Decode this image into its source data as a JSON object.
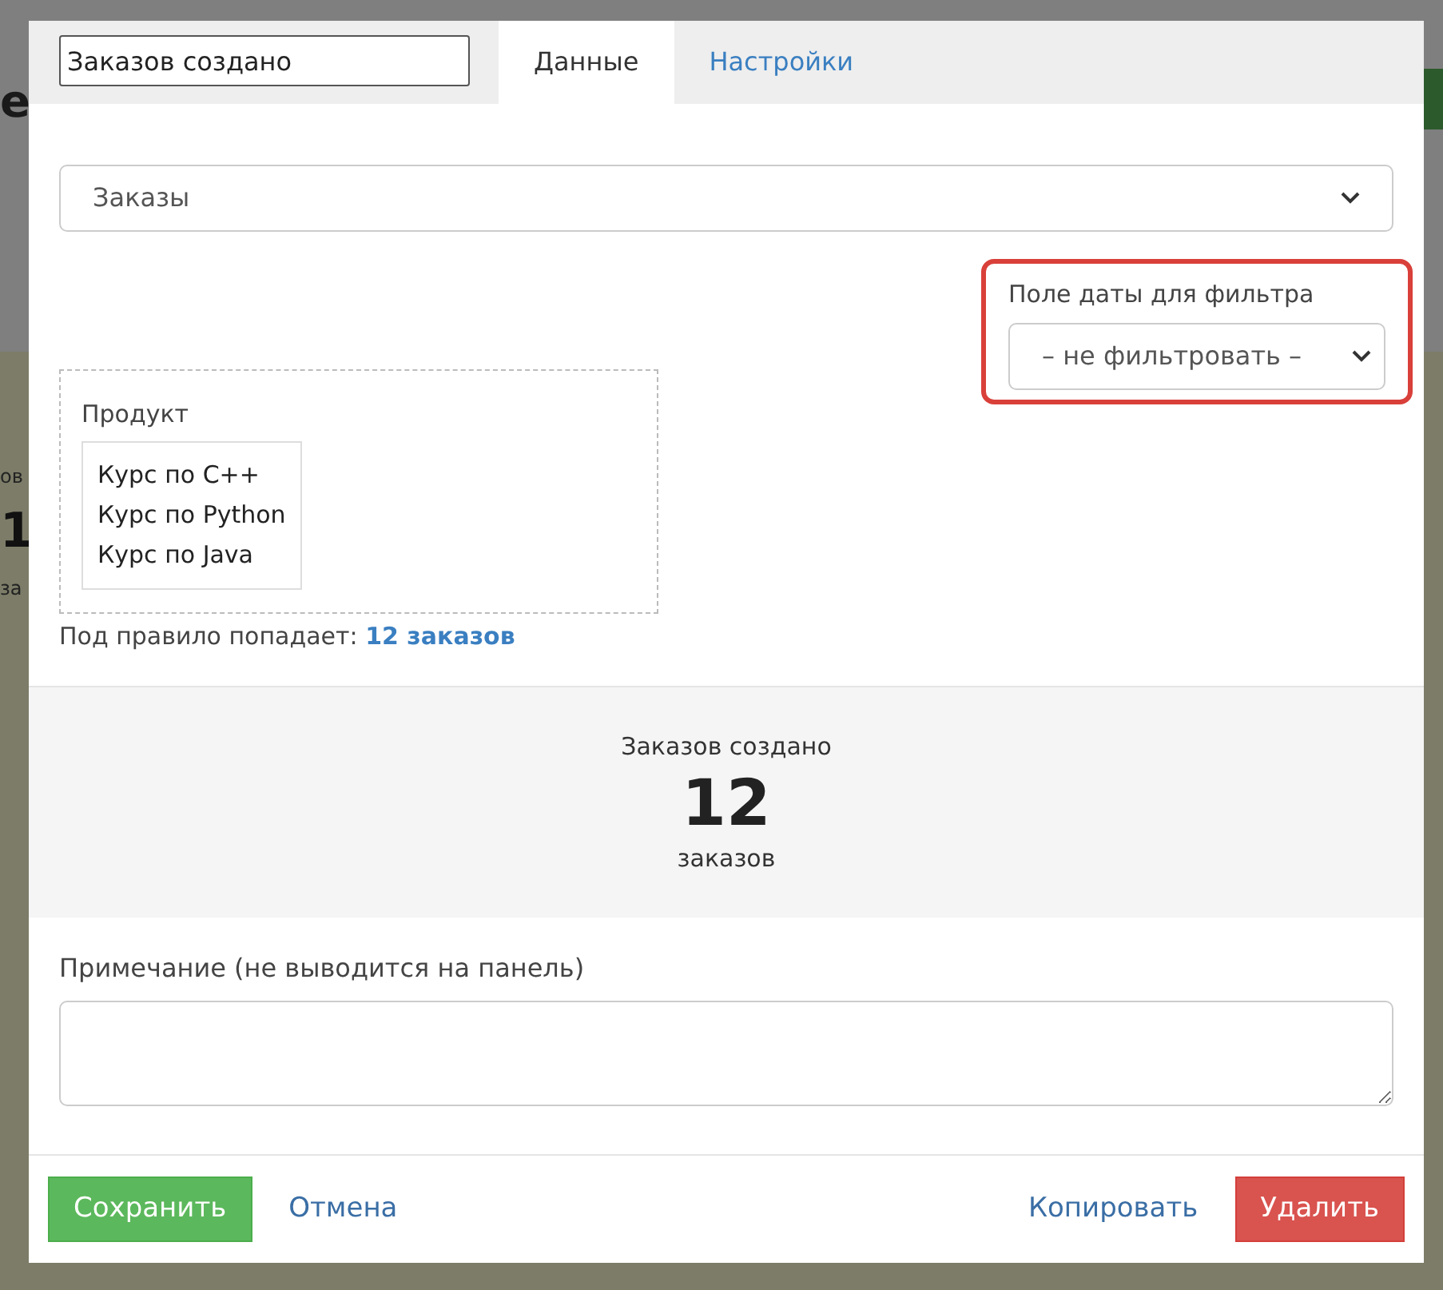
{
  "background": {
    "texts": [
      {
        "kind": "heading",
        "text": "е"
      },
      {
        "kind": "caption",
        "text": "ов"
      },
      {
        "kind": "number",
        "text": "1"
      },
      {
        "kind": "caption2",
        "text": "за"
      },
      {
        "kind": "button"
      }
    ]
  },
  "modal": {
    "name_input": {
      "value": "Заказов создано"
    },
    "tabs": [
      {
        "label": "Данные",
        "selected": true
      },
      {
        "label": "Настройки",
        "selected": false
      }
    ],
    "source_select": {
      "value": "Заказы"
    },
    "date_filter": {
      "label": "Поле даты для фильтра",
      "value": "– не фильтровать –",
      "highlighted": true
    },
    "filter_box": {
      "label": "Продукт",
      "options": [
        "Курс по C++",
        "Курс по Python",
        "Курс по Java"
      ]
    },
    "match_text": {
      "label": "Под правило попадает:",
      "link": "12 заказов"
    },
    "preview": {
      "title": "Заказов создано",
      "value": "12",
      "unit": "заказов"
    },
    "note": {
      "label": "Примечание (не выводится на панель)"
    },
    "footer": {
      "buttons": [
        {
          "kind": "primary",
          "label": "Сохранить"
        },
        {
          "kind": "link",
          "label": "Отмена"
        },
        {
          "kind": "spacer"
        },
        {
          "kind": "link",
          "label": "Копировать"
        },
        {
          "kind": "danger",
          "label": "Удалить"
        }
      ]
    }
  }
}
